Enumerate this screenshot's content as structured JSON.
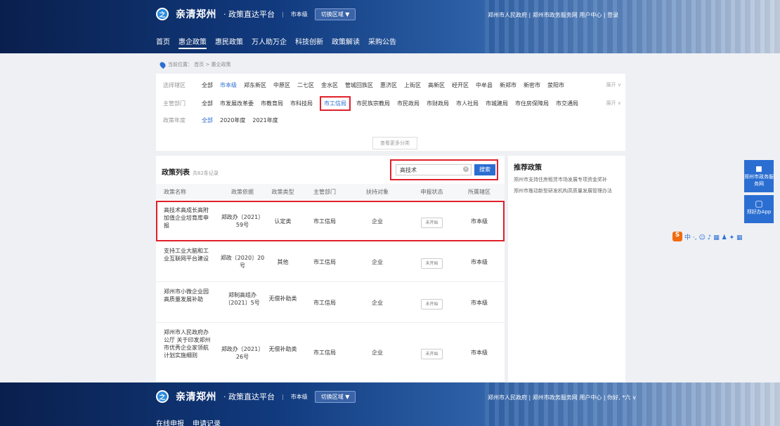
{
  "header": {
    "logo_mark": "之",
    "logo_text": "亲清郑州",
    "platform": "· 政策直达平台",
    "divider": "|",
    "level": "市本级",
    "switch_region": "切换区域 ▼",
    "links": "郑州市人民政府 | 郑州市政务服务网   用户中心 | 登录",
    "nav": [
      "首页",
      "惠企政策",
      "惠民政策",
      "万人助万企",
      "科技创新",
      "政策解读",
      "采购公告"
    ],
    "nav_active": "惠企政策"
  },
  "breadcrumb": {
    "text": "当前位置：  首页  >  惠企政策"
  },
  "filters": {
    "region_label": "选择辖区",
    "regions": [
      "全部",
      "市本级",
      "郑东新区",
      "中原区",
      "二七区",
      "金水区",
      "管城回族区",
      "惠济区",
      "上街区",
      "高新区",
      "经开区",
      "中牟县",
      "新郑市",
      "新密市",
      "荥阳市"
    ],
    "region_selected": "市本级",
    "dept_label": "主管部门",
    "depts": [
      "全部",
      "市发展改革委",
      "市教育局",
      "市科技局",
      "市工信局",
      "市民族宗教局",
      "市民政局",
      "市财政局",
      "市人社局",
      "市城建局",
      "市住房保障局",
      "市交通局"
    ],
    "dept_selected": "市工信局",
    "year_label": "政策年度",
    "years": [
      "全部",
      "2020年度",
      "2021年度"
    ],
    "year_selected": "全部",
    "expand_label": "展开 ∨",
    "more_label": "查看更多分类"
  },
  "list": {
    "title": "政策列表",
    "count": "共62条记录",
    "search_value": "高技术",
    "clear_icon": "×",
    "search_button": "搜索",
    "columns": [
      "政策名称",
      "政策依据",
      "政策类型",
      "主管部门",
      "扶持对象",
      "申报状态",
      "所属辖区"
    ],
    "rows": [
      {
        "name": "高技术高成长高附加值企业培育库申报",
        "basis": "郑政办〔2021〕59号",
        "type": "认定类",
        "dept": "市工信局",
        "target": "企业",
        "status": "未开始",
        "region": "市本级"
      },
      {
        "name": "支持工业大脑和工业互联网平台建设",
        "basis": "郑政〔2020〕20号",
        "type": "其他",
        "dept": "市工信局",
        "target": "企业",
        "status": "未开始",
        "region": "市本级"
      },
      {
        "name": "郑州市小微企业园高质量发展补助",
        "basis": "郑制高组办〔2021〕5号",
        "type": "无偿补助类",
        "dept": "市工信局",
        "target": "企业",
        "status": "未开始",
        "region": "市本级"
      },
      {
        "name": "郑州市人民政府办公厅 关于印发郑州市优秀企业家领航计划实施细则",
        "basis": "郑政办〔2021〕26号",
        "type": "无偿补助类",
        "dept": "市工信局",
        "target": "企业",
        "status": "未开始",
        "region": "市本级"
      }
    ]
  },
  "recommend": {
    "title": "推荐政策",
    "items": [
      "郑州市支持住房租赁市场发展专项资金奖补",
      "郑州市推动新型研发机构高质量发展管理办法"
    ]
  },
  "side": {
    "portal": "郑州市政务服务网",
    "app": "郑好办App",
    "portal_icon": "◼",
    "app_icon": "▢"
  },
  "ime": {
    "logo": "S",
    "items": "中 ·, ☺ ♪ ▦ ♟ ✦ ▦"
  },
  "bottom_header": {
    "links": "郑州市人民政府 | 郑州市政务服务网   用户中心 | 你好, *六 ∨",
    "nav": [
      "在线申报",
      "申请记录"
    ]
  }
}
